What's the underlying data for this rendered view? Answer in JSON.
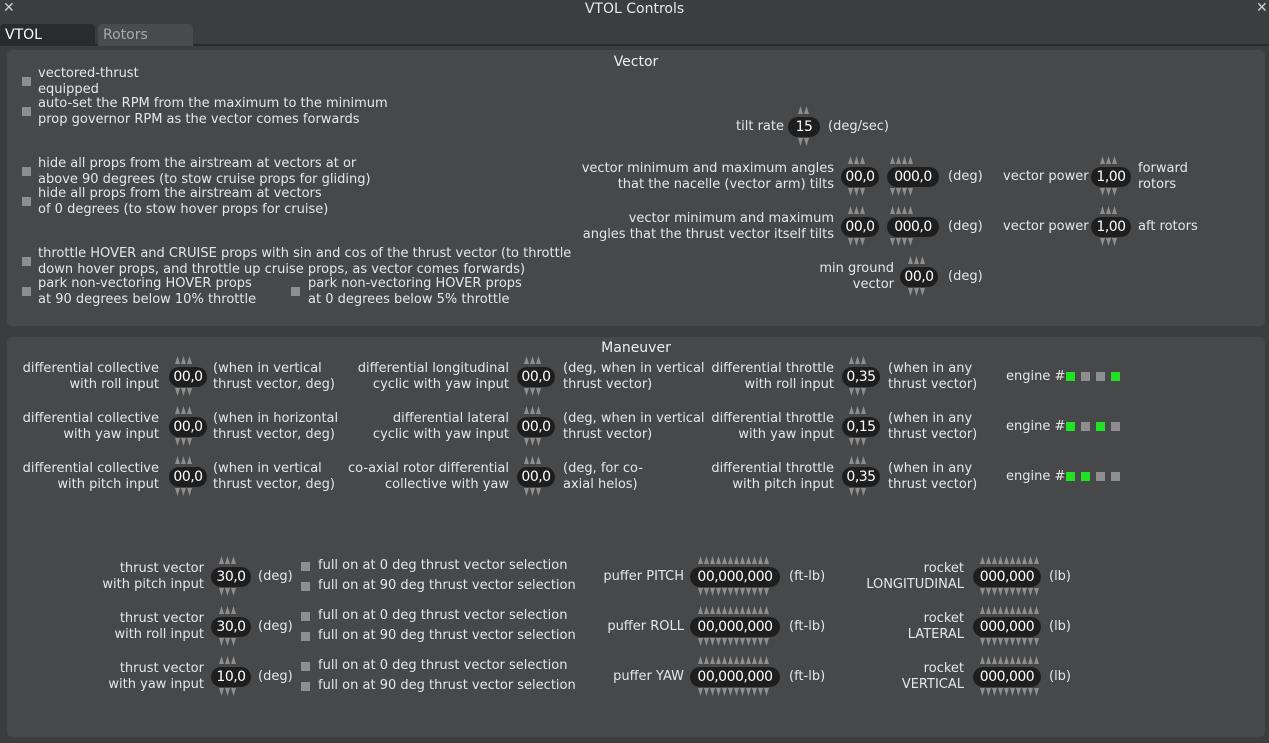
{
  "window": {
    "title": "VTOL Controls",
    "close": "✕"
  },
  "tabs": [
    {
      "label": "VTOL",
      "active": true
    },
    {
      "label": "Rotors",
      "active": false
    }
  ],
  "vector": {
    "title": "Vector",
    "opt_vectored": "vectored-thrust\nequipped",
    "opt_autorpm": "auto-set the RPM from the maximum to the minimum\nprop governor RPM as the vector comes forwards",
    "opt_hide90": "hide all props from the airstream at vectors at or\nabove 90 degrees (to stow cruise props for gliding)",
    "opt_hide0": "hide all props from the airstream at vectors\nof 0 degrees (to stow hover props for cruise)",
    "opt_throttle": "throttle HOVER and CRUISE props with sin and cos of the thrust vector (to throttle\ndown hover props, and throttle up cruise props, as vector comes forwards)",
    "opt_park90": "park non-vectoring HOVER props\nat 90 degrees below 10% throttle",
    "opt_park0": "park non-vectoring HOVER props\nat 0 degrees below 5% throttle",
    "tilt_label": "tilt rate",
    "tilt_value": "15",
    "tilt_unit": "(deg/sec)",
    "nacelle_label": "vector minimum and maximum angles\nthat the nacelle (vector arm) tilts",
    "nacelle_min": "00,0",
    "nacelle_max": "000,0",
    "nacelle_unit": "(deg)",
    "thrust_label": "vector minimum and maximum\nangles that the thrust vector itself tilts",
    "thrust_min": "00,0",
    "thrust_max": "000,0",
    "thrust_unit": "(deg)",
    "ground_label": "min ground\nvector",
    "ground_value": "00,0",
    "ground_unit": "(deg)",
    "power_fwd_label": "vector power",
    "power_fwd_value": "1,00",
    "power_fwd_suffix": "forward\nrotors",
    "power_aft_label": "vector power",
    "power_aft_value": "1,00",
    "power_aft_suffix": "aft rotors"
  },
  "maneuver": {
    "title": "Maneuver",
    "dc_roll_label": "differential collective\nwith roll input",
    "dc_roll_value": "00,0",
    "dc_roll_note": "(when in vertical\nthrust vector, deg)",
    "dc_yaw_label": "differential collective\nwith yaw input",
    "dc_yaw_value": "00,0",
    "dc_yaw_note": "(when in horizontal\nthrust vector, deg)",
    "dc_pitch_label": "differential collective\nwith pitch input",
    "dc_pitch_value": "00,0",
    "dc_pitch_note": "(when in vertical\nthrust vector, deg)",
    "dlong_label": "differential longitudinal\ncyclic with yaw input",
    "dlong_value": "00,0",
    "dlong_note": "(deg, when in vertical\nthrust vector)",
    "dlat_label": "differential lateral\ncyclic with yaw input",
    "dlat_value": "00,0",
    "dlat_note": "(deg, when in vertical\nthrust vector)",
    "coax_label": "co-axial rotor differential\ncollective with yaw",
    "coax_value": "00,0",
    "coax_note": "(deg, for co-\naxial helos)",
    "dt_roll_label": "differential throttle\nwith roll input",
    "dt_roll_value": "0,35",
    "dt_roll_note": "(when in any\nthrust vector)",
    "dt_yaw_label": "differential throttle\nwith yaw input",
    "dt_yaw_value": "0,15",
    "dt_yaw_note": "(when in any\nthrust vector)",
    "dt_pitch_label": "differential throttle\nwith pitch input",
    "dt_pitch_value": "0,35",
    "dt_pitch_note": "(when in any\nthrust vector)",
    "engine_label": "engine #",
    "engine_rows": [
      [
        true,
        false,
        false,
        true
      ],
      [
        true,
        false,
        true,
        false
      ],
      [
        true,
        true,
        false,
        false
      ]
    ],
    "tv_pitch_label": "thrust vector\nwith pitch input",
    "tv_pitch_value": "30,0",
    "tv_roll_label": "thrust vector\nwith roll input",
    "tv_roll_value": "30,0",
    "tv_yaw_label": "thrust vector\nwith yaw input",
    "tv_yaw_value": "10,0",
    "deg": "(deg)",
    "sel0": "full on at 0 deg thrust vector selection",
    "sel90": "full on at 90 deg thrust vector selection",
    "puffer_pitch_label": "puffer PITCH",
    "puffer_roll_label": "puffer ROLL",
    "puffer_yaw_label": "puffer YAW",
    "puffer_value": "00,000,000",
    "puffer_unit": "(ft-lb)",
    "rocket_long_label": "rocket\nLONGITUDINAL",
    "rocket_lat_label": "rocket\nLATERAL",
    "rocket_vert_label": "rocket\nVERTICAL",
    "rocket_value": "000,000",
    "rocket_unit": "(lb)"
  },
  "colors": {
    "background": "#3c3d3e",
    "panel": "#474849",
    "field": "#1e1e1e",
    "checkbox": "#8e8e8e",
    "engine_on": "#22e022"
  }
}
